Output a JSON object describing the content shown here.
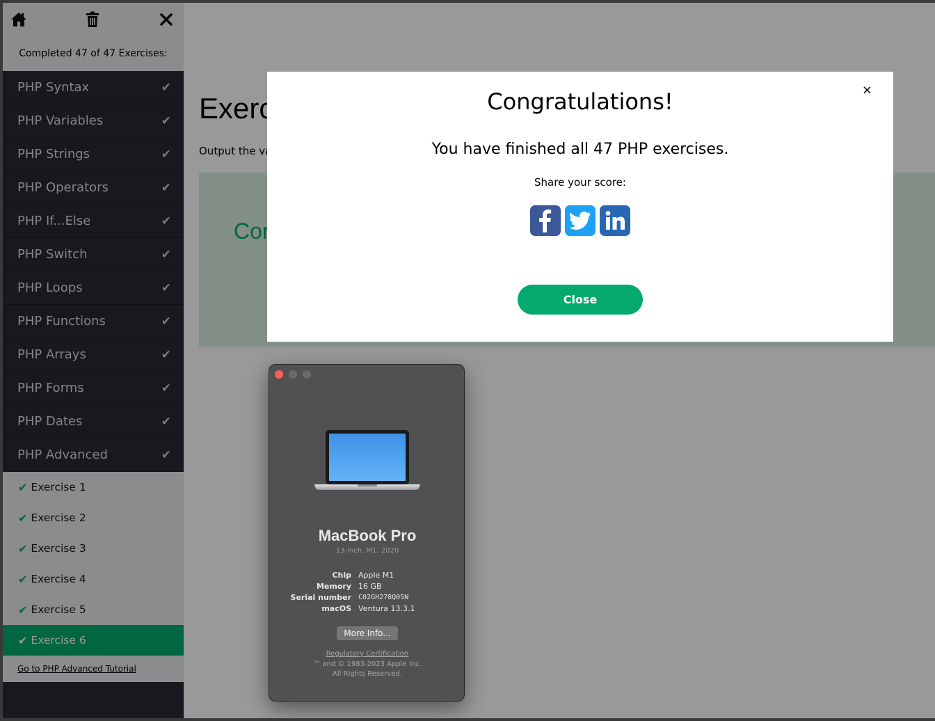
{
  "sidebar": {
    "icons": {
      "home": "home-icon",
      "trash": "trash-icon",
      "close": "close-icon"
    },
    "progress": "Completed 47 of 47 Exercises:",
    "categories": [
      {
        "label": "PHP Syntax"
      },
      {
        "label": "PHP Variables"
      },
      {
        "label": "PHP Strings"
      },
      {
        "label": "PHP Operators"
      },
      {
        "label": "PHP If...Else"
      },
      {
        "label": "PHP Switch"
      },
      {
        "label": "PHP Loops"
      },
      {
        "label": "PHP Functions"
      },
      {
        "label": "PHP Arrays"
      },
      {
        "label": "PHP Forms"
      },
      {
        "label": "PHP Dates"
      },
      {
        "label": "PHP Advanced"
      }
    ],
    "check_glyph": "✔",
    "exercises": [
      {
        "label": "Exercise 1"
      },
      {
        "label": "Exercise 2"
      },
      {
        "label": "Exercise 3"
      },
      {
        "label": "Exercise 4"
      },
      {
        "label": "Exercise 5"
      },
      {
        "label": "Exercise 6",
        "active": true
      }
    ],
    "tutorial_link": "Go to PHP Advanced Tutorial"
  },
  "main": {
    "title": "Exerc",
    "description": "Output the va",
    "result": "Cor"
  },
  "modal": {
    "close_x": "×",
    "title": "Congratulations!",
    "message": "You have finished all 47 PHP exercises.",
    "share_label": "Share your score:",
    "share_icons": [
      "facebook-icon",
      "twitter-icon",
      "linkedin-icon"
    ],
    "close_button": "Close"
  },
  "about_window": {
    "name": "MacBook Pro",
    "model": "13-inch, M1, 2020",
    "specs": [
      {
        "key": "Chip",
        "value": "Apple M1"
      },
      {
        "key": "Memory",
        "value": "16 GB"
      },
      {
        "key": "Serial number",
        "value": "C02GH278Q05N"
      },
      {
        "key": "macOS",
        "value": "Ventura 13.3.1"
      }
    ],
    "more_info": "More Info...",
    "regulatory": "Regulatory Certification",
    "copyright_line1": "™ and © 1983-2023 Apple Inc.",
    "copyright_line2": "All Rights Reserved."
  },
  "colors": {
    "accent_green": "#04aa6d",
    "sidebar_dark": "#282a35",
    "facebook": "#3b5998",
    "twitter": "#1da1f2",
    "linkedin": "#2867b2"
  }
}
